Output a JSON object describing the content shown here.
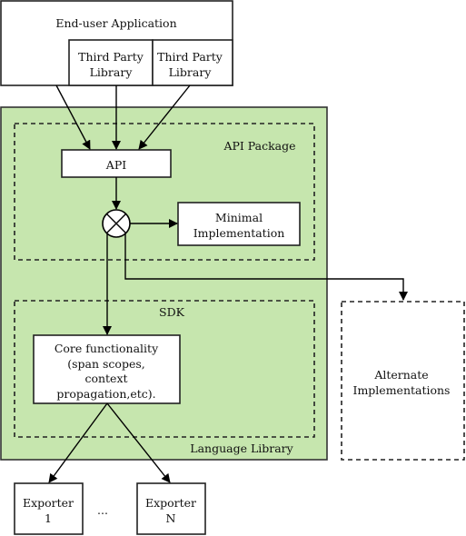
{
  "colors": {
    "language_library_fill": "#c6e6ae",
    "stroke": "#222222"
  },
  "nodes": {
    "end_user_app": "End-user Application",
    "third_party_1": [
      "Third Party",
      "Library"
    ],
    "third_party_2": [
      "Third Party",
      "Library"
    ],
    "api_package": "API Package",
    "api": "API",
    "minimal_impl": [
      "Minimal",
      "Implementation"
    ],
    "sdk": "SDK",
    "core": [
      "Core functionality",
      "(span scopes,",
      "context",
      "propagation,etc)."
    ],
    "language_library": "Language Library",
    "alternate_impl": [
      "Alternate",
      "Implementations"
    ],
    "exporter_1": [
      "Exporter",
      "1"
    ],
    "ellipsis": "...",
    "exporter_n": [
      "Exporter",
      "N"
    ]
  }
}
